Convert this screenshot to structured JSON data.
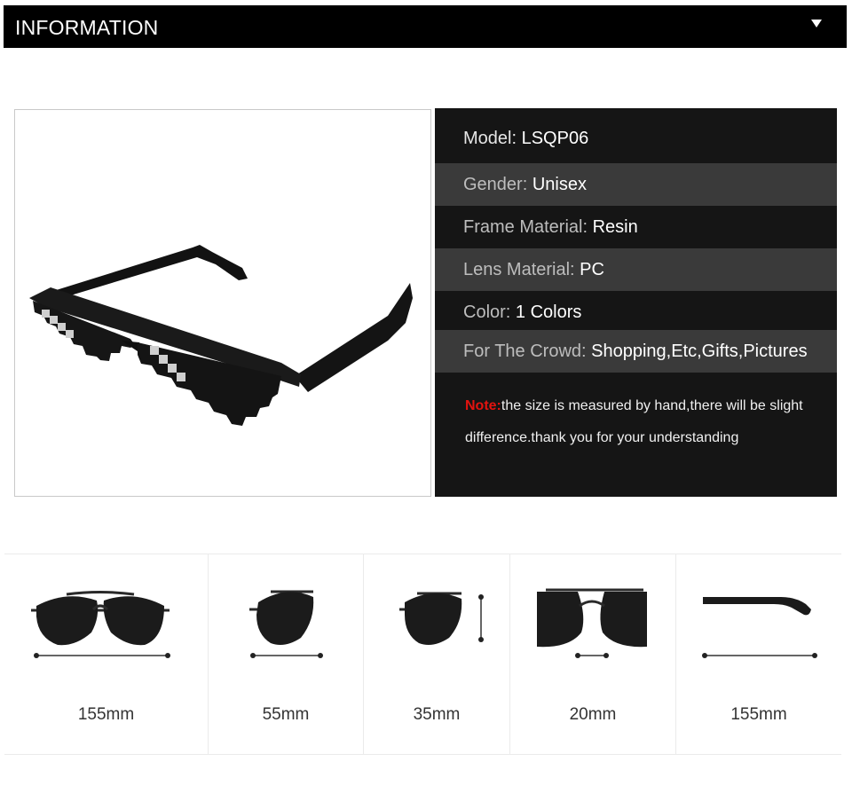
{
  "header": {
    "title": "INFORMATION",
    "toggle_icon": "triangle-down-icon"
  },
  "product_image": {
    "subject": "pixel-sunglasses"
  },
  "specs": [
    {
      "label": "Model: ",
      "value": "LSQP06",
      "label_dim": false
    },
    {
      "label": "Gender: ",
      "value": "Unisex",
      "label_dim": true
    },
    {
      "label": "Frame Material: ",
      "value": "Resin",
      "label_dim": true
    },
    {
      "label": " Lens Material: ",
      "value": "PC",
      "label_dim": true
    },
    {
      "label": "Color: ",
      "value": "1 Colors",
      "label_dim": true
    },
    {
      "label": "For The Crowd: ",
      "value": "Shopping,Etc,Gifts,Pictures",
      "label_dim": true
    }
  ],
  "note": {
    "label": "Note:",
    "text": "the size is measured by hand,there will be slight difference.thank you for your understanding",
    "label_color": "#e3130f"
  },
  "dimensions": [
    {
      "value": "155mm",
      "icon": "glasses-total-width-icon"
    },
    {
      "value": "55mm",
      "icon": "lens-width-icon"
    },
    {
      "value": "35mm",
      "icon": "lens-height-icon"
    },
    {
      "value": "20mm",
      "icon": "bridge-width-icon"
    },
    {
      "value": "155mm",
      "icon": "temple-length-icon"
    }
  ]
}
